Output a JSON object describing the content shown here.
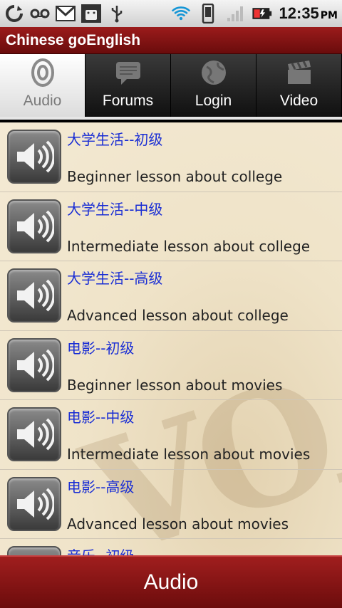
{
  "status_bar": {
    "time": "12:35",
    "ampm": "PM",
    "icons": [
      "sync-icon",
      "voicemail-icon",
      "gmail-icon",
      "android-debug-icon",
      "usb-icon",
      "wifi-icon",
      "vibrate-icon",
      "signal-icon",
      "battery-charging-icon"
    ]
  },
  "app": {
    "title": "Chinese goEnglish"
  },
  "tabs": [
    {
      "label": "Audio",
      "icon": "audio-icon",
      "active": true
    },
    {
      "label": "Forums",
      "icon": "forums-icon",
      "active": false
    },
    {
      "label": "Login",
      "icon": "globe-icon",
      "active": false
    },
    {
      "label": "Video",
      "icon": "clapperboard-icon",
      "active": false
    }
  ],
  "lessons": [
    {
      "title": "大学生活--初级",
      "desc": "Beginner lesson about college"
    },
    {
      "title": "大学生活--中级",
      "desc": "Intermediate lesson about college"
    },
    {
      "title": "大学生活--高级",
      "desc": "Advanced lesson about college"
    },
    {
      "title": "电影--初级",
      "desc": "Beginner lesson about movies"
    },
    {
      "title": "电影--中级",
      "desc": "Intermediate lesson about movies"
    },
    {
      "title": "电影--高级",
      "desc": "Advanced lesson about movies"
    },
    {
      "title": "音乐--初级",
      "desc": ""
    }
  ],
  "bottom_bar": {
    "label": "Audio"
  },
  "colors": {
    "accent": "#8b1414",
    "link": "#1a2ed4"
  }
}
